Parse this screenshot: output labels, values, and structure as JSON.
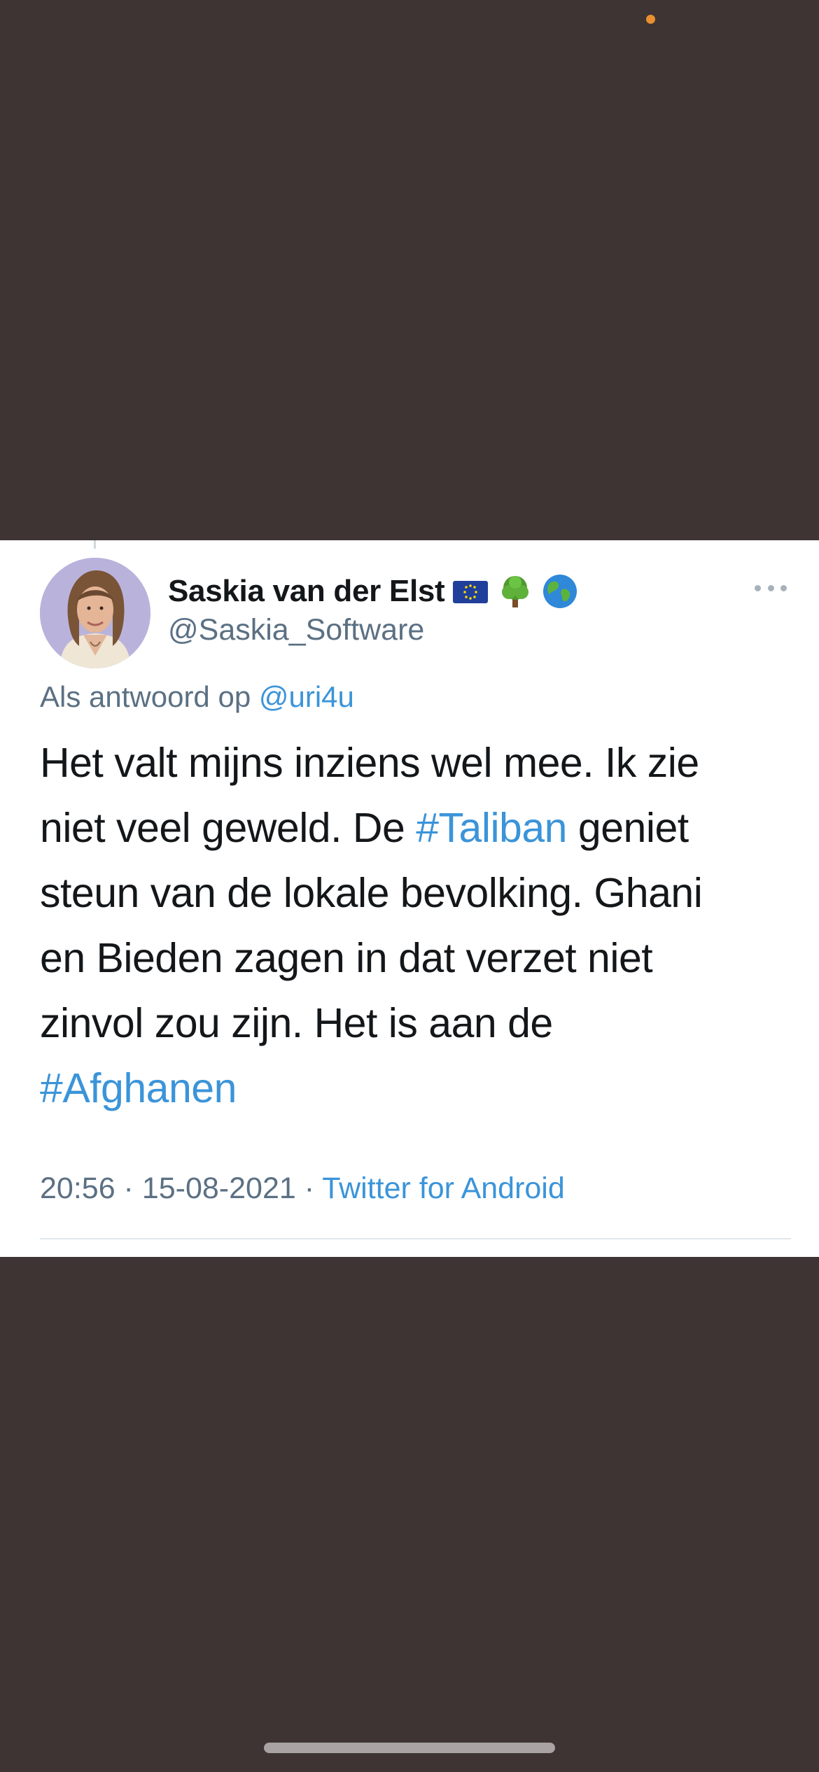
{
  "tweet": {
    "author": {
      "display_name": "Saskia van der Elst",
      "handle": "@Saskia_Software",
      "badges": [
        "eu-flag-icon",
        "tree-icon",
        "globe-icon"
      ]
    },
    "reply_context": {
      "prefix": "Als antwoord op",
      "mention": "@uri4u"
    },
    "lines": [
      [
        "Het valt mijns inziens wel mee. Ik zie"
      ],
      [
        "niet veel geweld. De ",
        "#Taliban",
        " geniet"
      ],
      [
        "steun van de lokale bevolking. Ghani"
      ],
      [
        "en Bieden zagen in dat verzet niet"
      ],
      [
        "zinvol zou zijn. Het is aan de"
      ],
      [
        "#Afghanen"
      ]
    ],
    "line1": "Het valt mijns inziens wel mee. Ik zie",
    "line2_a": "niet veel geweld. De ",
    "line2_tag": "#Taliban",
    "line2_b": " geniet",
    "line3": "steun van de lokale bevolking. Ghani",
    "line4": "en Bieden zagen in dat verzet niet",
    "line5": "zinvol zou zijn. Het is aan de",
    "line6_tag": "#Afghanen",
    "time": "20:56",
    "separator": " · ",
    "date": "15-08-2021",
    "source": "Twitter for Android"
  },
  "colors": {
    "background": "#3e3434",
    "card": "#ffffff",
    "text": "#14171a",
    "secondary_text": "#5b7083",
    "link": "#3b94d9",
    "status_dot": "#e8902f"
  },
  "icons": {
    "more": "more-horizontal-icon"
  }
}
